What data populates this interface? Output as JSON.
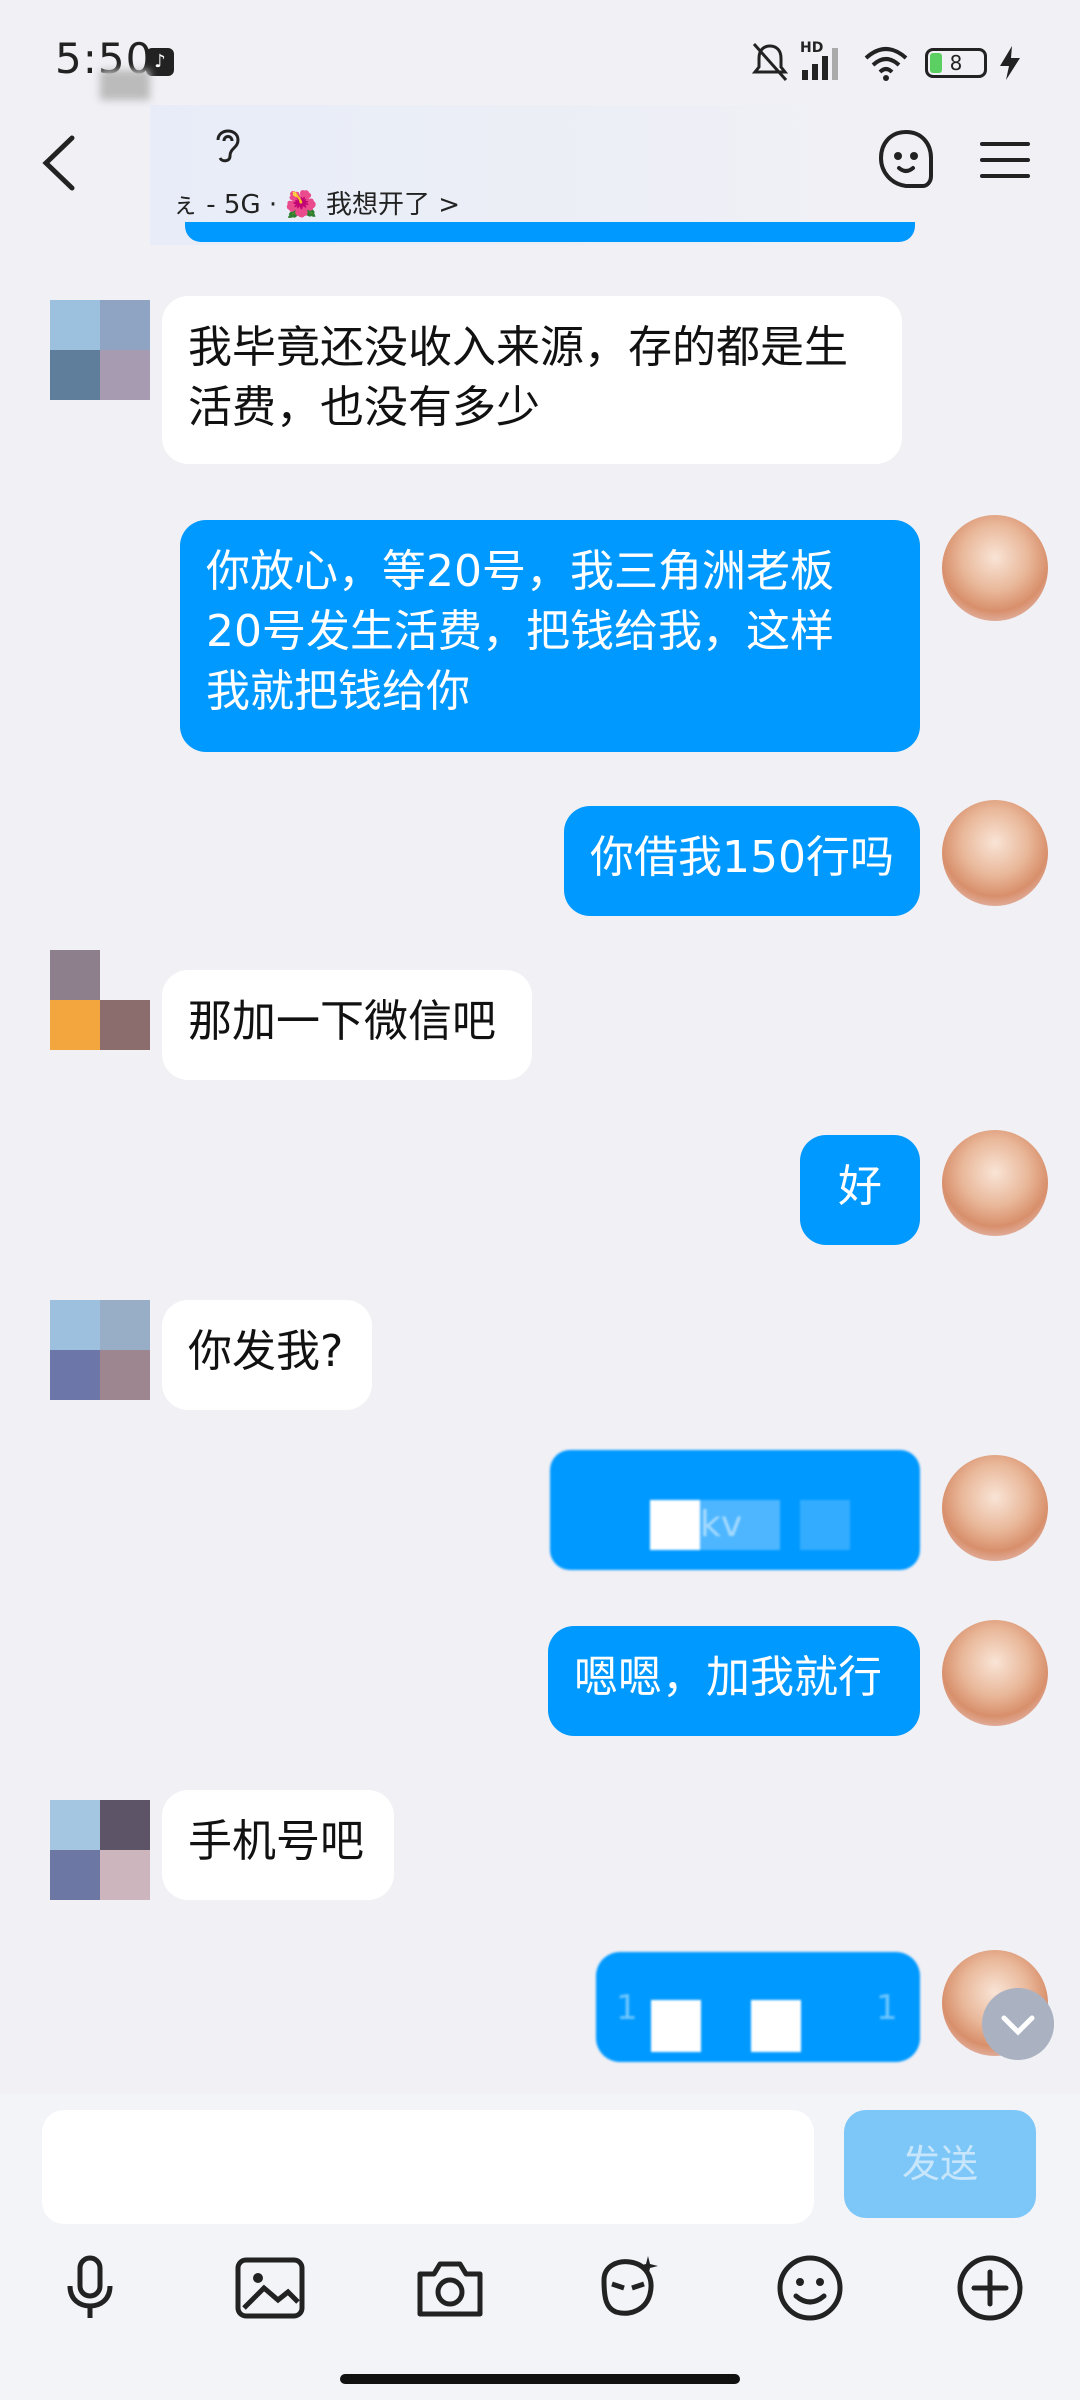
{
  "status_bar": {
    "time": "5:50",
    "battery_level": "8",
    "network_badge": "HD"
  },
  "header": {
    "title_icon": "ear-icon",
    "subtitle": "ぇ - 5G · 🌺 我想开了 >"
  },
  "messages": [
    {
      "side": "left",
      "text_lines": [
        "我毕竟还没收入来源，存的都是生",
        "活费，也没有多少"
      ]
    },
    {
      "side": "right",
      "text_lines": [
        "你放心，等20号，我三角洲老板",
        "20号发生活费，把钱给我，这样",
        "我就把钱给你"
      ]
    },
    {
      "side": "right",
      "text_lines": [
        "你借我150行吗"
      ]
    },
    {
      "side": "left",
      "text_lines": [
        "那加一下微信吧"
      ]
    },
    {
      "side": "right",
      "text_lines": [
        "好"
      ]
    },
    {
      "side": "left",
      "text_lines": [
        "你发我?"
      ]
    },
    {
      "side": "right",
      "text_lines": [
        "kv"
      ],
      "redacted": true
    },
    {
      "side": "right",
      "text_lines": [
        "嗯嗯，加我就行"
      ]
    },
    {
      "side": "left",
      "text_lines": [
        "手机号吧"
      ]
    },
    {
      "side": "right",
      "text_lines": [
        "1",
        "1"
      ],
      "redacted": true
    }
  ],
  "composer": {
    "input_value": "",
    "send_label": "发送"
  },
  "toolbar": {
    "icons": [
      "microphone-icon",
      "image-icon",
      "camera-icon",
      "sticker-icon",
      "emoji-icon",
      "plus-icon"
    ]
  },
  "colors": {
    "sent_bubble": "#0099ff",
    "received_bubble": "#ffffff",
    "background": "#f0f0f5",
    "send_button": "#7cc7f8"
  }
}
